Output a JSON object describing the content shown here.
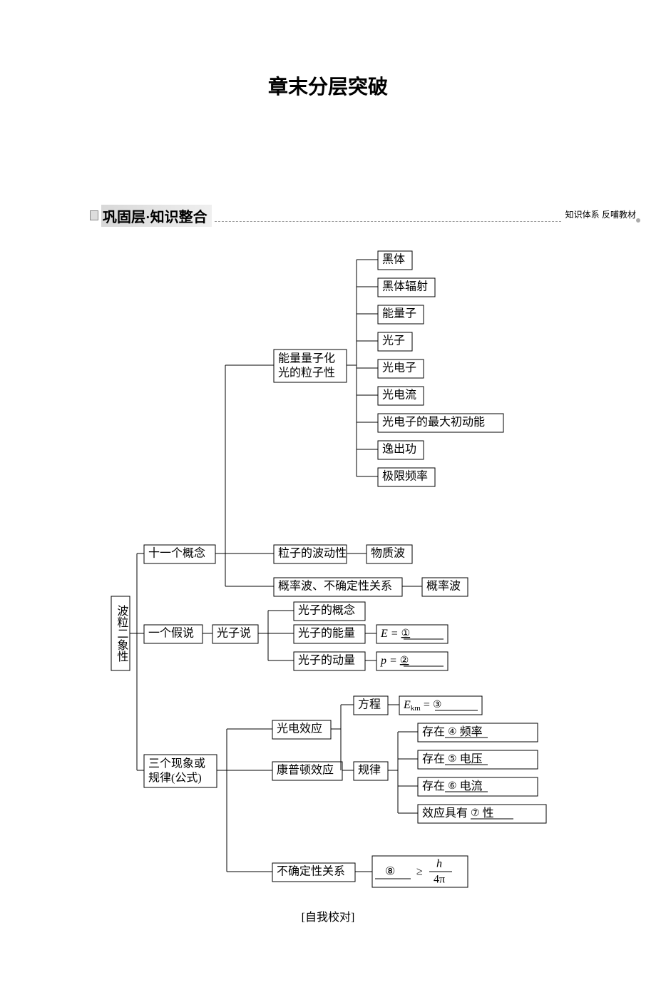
{
  "title": "章末分层突破",
  "section_title": "巩固层·知识整合",
  "section_tag": "知识体系  反哺教材",
  "footer": "[自我校对]",
  "root": "波粒二象性",
  "br1": "十一个概念",
  "br1a": "能量量子化光的粒子性",
  "br1a_children": [
    "黑体",
    "黑体辐射",
    "能量子",
    "光子",
    "光电子",
    "光电流",
    "光电子的最大初动能",
    "逸出功",
    "极限频率"
  ],
  "br1b": "粒子的波动性",
  "br1b_c": "物质波",
  "br1c": "概率波、不确定性关系",
  "br1c_c": "概率波",
  "br2": "一个假说",
  "br2a": "光子说",
  "br2a_children": [
    "光子的概念",
    "光子的能量",
    "光子的动量"
  ],
  "E_eq_prefix": "E =",
  "p_eq_prefix": "p =",
  "blank1": "①",
  "blank2": "②",
  "br3": {
    "l1": "三个现象或",
    "l2": "规律(公式)"
  },
  "br3a": "光电效应",
  "br3b": "康普顿效应",
  "br3c": "不确定性关系",
  "eq_label": "方程",
  "Ekm_prefix": "E",
  "Ekm_sub": "km",
  "eq_mid": " =",
  "blank3": "③",
  "law_label": "规律",
  "law_rows": {
    "r1_a": "存在",
    "r1_b": "④",
    "r1_c": "频率",
    "r2_a": "存在",
    "r2_b": "⑤",
    "r2_c": "电压",
    "r3_a": "存在",
    "r3_b": "⑥",
    "r3_c": "电流",
    "r4_a": "效应具有",
    "r4_b": "⑦",
    "r4_c": "性"
  },
  "blank8": "⑧",
  "geq": "≥",
  "h_sym": "h",
  "pi_denom": "4π"
}
